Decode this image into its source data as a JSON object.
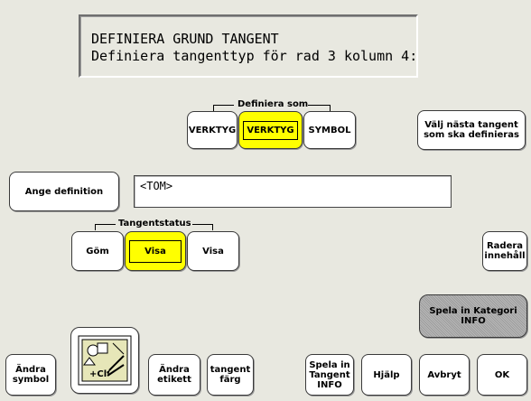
{
  "header": {
    "line1": "DEFINIERA GRUND TANGENT",
    "line2": "Definiera tangenttyp för rad 3 kolumn 4:"
  },
  "define_as": {
    "label": "Definiera som",
    "options": [
      "VERKTYG",
      "VERKTYG",
      "SYMBOL"
    ],
    "selected_index": 1
  },
  "next_key_button": "Välj nästa tangent\nsom ska definieras",
  "enter_definition_button": "Ange definition",
  "definition_value": "<TOM>",
  "key_status": {
    "label": "Tangentstatus",
    "options": [
      "Göm",
      "Visa",
      "Visa"
    ],
    "selected_index": 1
  },
  "clear_content_button": "Radera\ninnehåll",
  "record_category_button": "Spela in Kategori\nINFO",
  "bottom_toolbar": {
    "change_symbol": "Ändra\nsymbol",
    "symbol_icon_text": "+Cl",
    "change_label": "Ändra\netikett",
    "key_color": "tangent\nfärg",
    "record_key_info": "Spela in\nTangent\nINFO",
    "help": "Hjälp",
    "cancel": "Avbryt",
    "ok": "OK"
  },
  "colors": {
    "background": "#e8e8e0",
    "selected": "#ffff00",
    "button": "#ffffff"
  }
}
